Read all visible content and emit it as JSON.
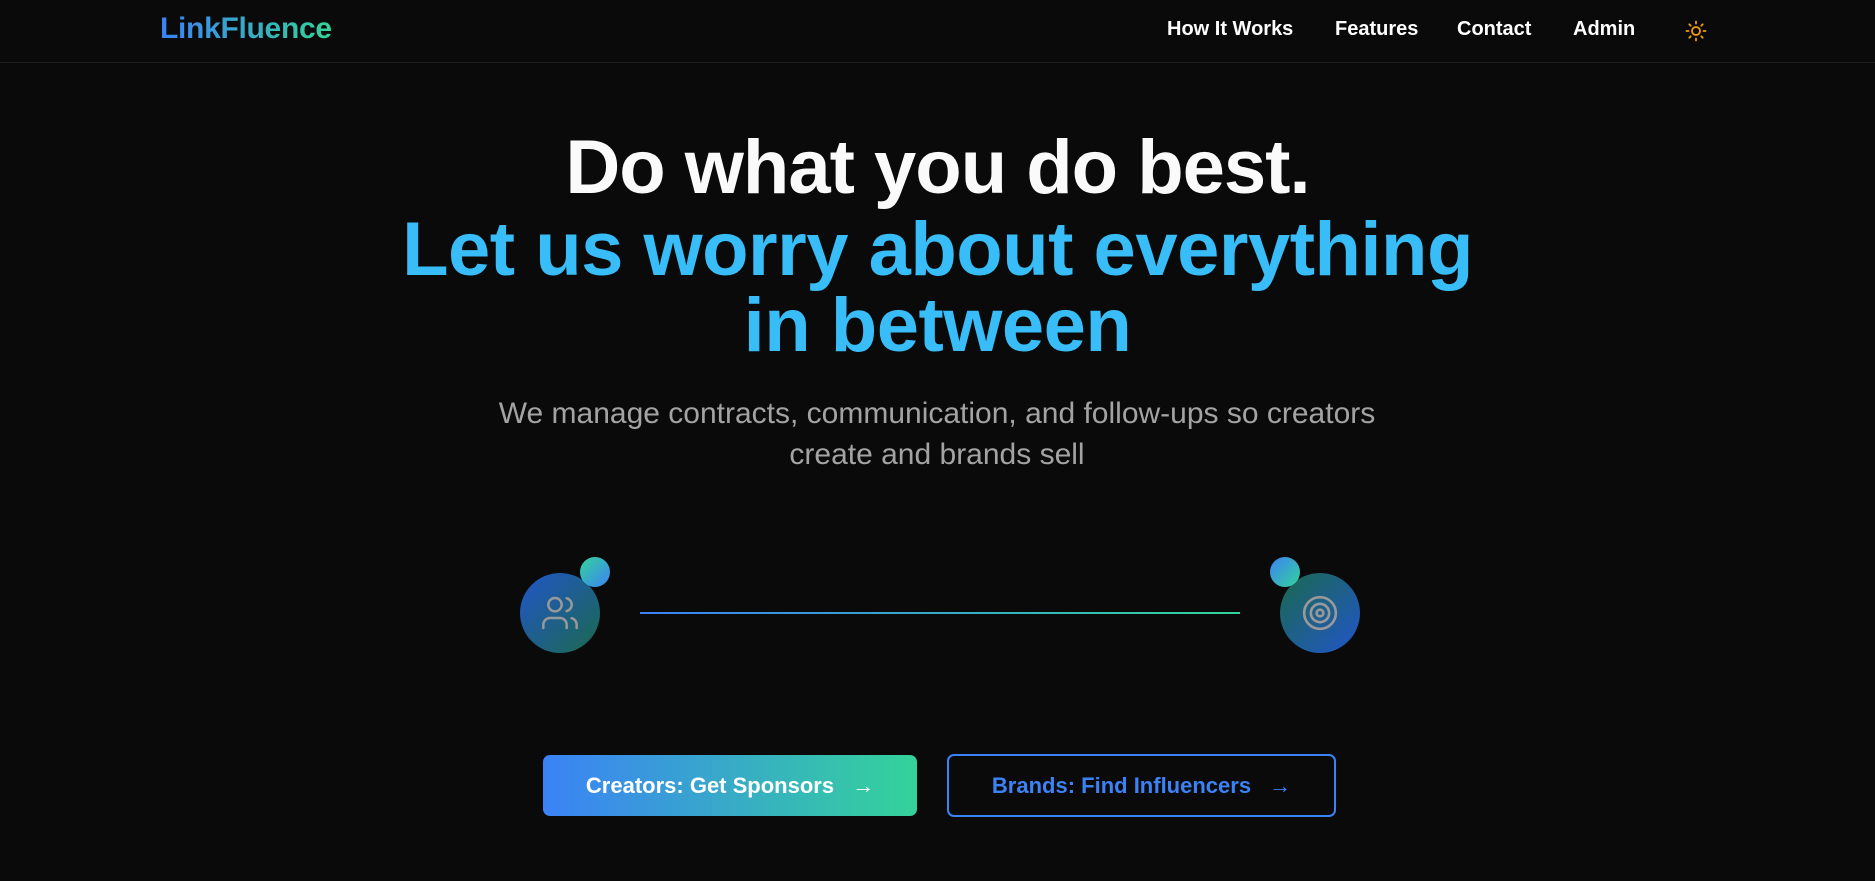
{
  "brand": {
    "name": "LinkFluence"
  },
  "nav": {
    "items": [
      {
        "label": "How It Works"
      },
      {
        "label": "Features"
      },
      {
        "label": "Contact"
      },
      {
        "label": "Admin"
      }
    ],
    "theme_icon": "sun-icon"
  },
  "hero": {
    "title": "Do what you do best.",
    "subtitle_line1": "Let us worry about everything",
    "subtitle_line2": "in between",
    "description_line1": "We manage contracts, communication, and follow-ups so creators",
    "description_line2": "create and brands sell"
  },
  "flow": {
    "left_icon": "users-icon",
    "right_icon": "target-icon"
  },
  "cta": {
    "primary_label": "Creators: Get Sponsors",
    "secondary_label": "Brands: Find Influencers",
    "arrow": "→"
  },
  "colors": {
    "background": "#0a0a0a",
    "accent_blue": "#3b82f6",
    "accent_green": "#34d399",
    "sky": "#38bdf8"
  }
}
